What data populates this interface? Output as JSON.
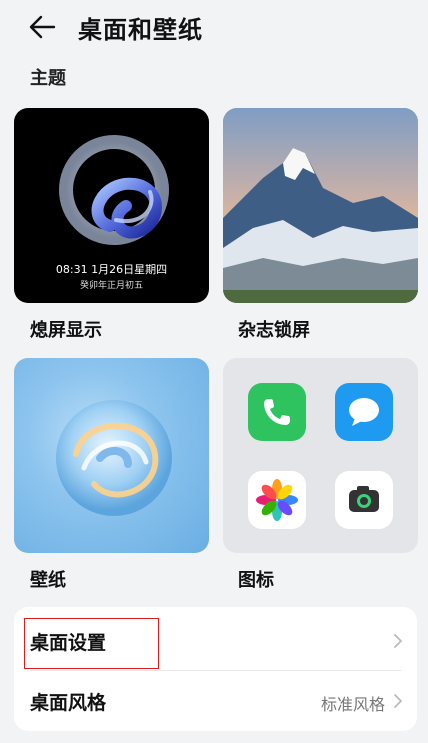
{
  "header": {
    "title": "桌面和壁纸",
    "back_icon": "back-arrow-icon"
  },
  "section": {
    "label": "主题"
  },
  "cards": {
    "aod": {
      "label": "熄屏显示",
      "time": "08:31 1月26日星期四",
      "lunar": "癸卯年正月初五"
    },
    "magazine": {
      "label": "杂志锁屏"
    },
    "wallpaper": {
      "label": "壁纸"
    },
    "icons": {
      "label": "图标",
      "apps": [
        "phone-icon",
        "message-icon",
        "gallery-icon",
        "camera-icon"
      ]
    }
  },
  "settings": {
    "desktop_settings": {
      "label": "桌面设置"
    },
    "desktop_style": {
      "label": "桌面风格",
      "value": "标准风格"
    }
  },
  "colors": {
    "accent_phone": "#2ec35f",
    "accent_message": "#1e9bf0",
    "highlight": "#d81e1e"
  }
}
